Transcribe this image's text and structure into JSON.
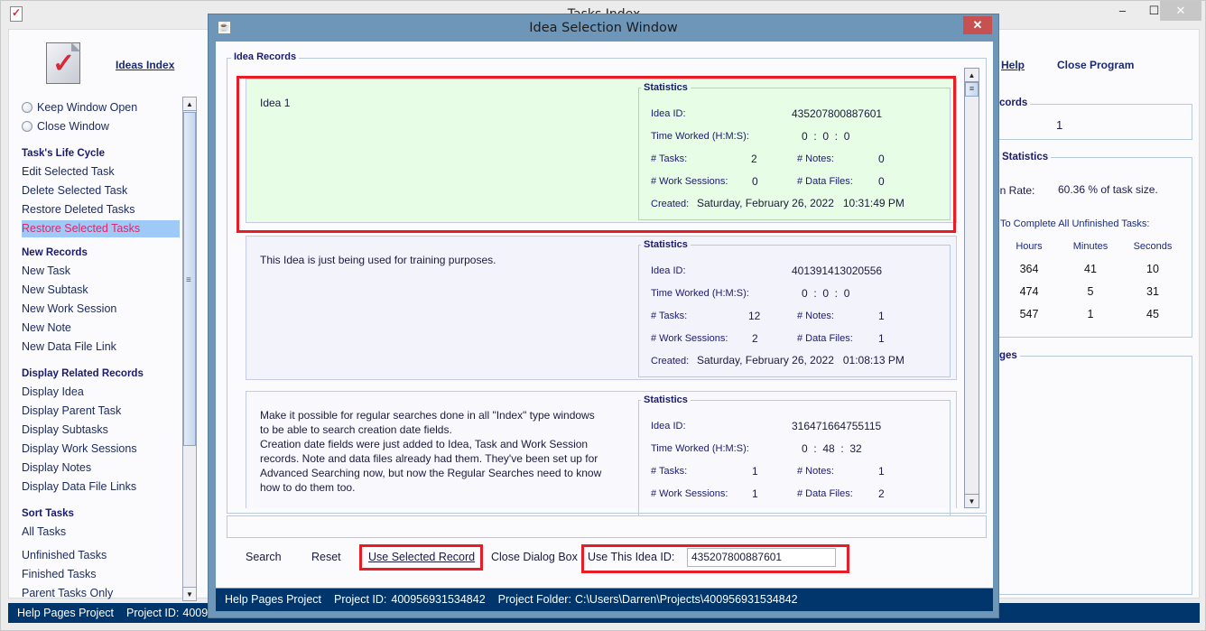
{
  "main_window": {
    "title": "Tasks Index",
    "controls": {
      "minimize": "–",
      "maximize": "☐",
      "close": "✕"
    },
    "top_links": {
      "ideas_index": "Ideas Index",
      "help": "Help",
      "close_program": "Close Program"
    },
    "radios": [
      {
        "label": "Keep Window Open",
        "checked": false
      },
      {
        "label": "Close Window",
        "checked": false
      }
    ],
    "sidebar": {
      "life_cycle_header": "Task's Life Cycle",
      "life_cycle": [
        "Edit Selected Task",
        "Delete Selected Task",
        "Restore Deleted Tasks",
        "Restore Selected Tasks"
      ],
      "new_records_header": "New Records",
      "new_records": [
        "New Task",
        "New Subtask",
        "New Work Session",
        "New Note",
        "New Data File Link"
      ],
      "display_header": "Display Related Records",
      "display": [
        "Display Idea",
        "Display Parent Task",
        "Display Subtasks",
        "Display Work Sessions",
        "Display Notes",
        "Display Data File Links"
      ],
      "sort_header": "Sort Tasks",
      "sort": [
        "All Tasks",
        "Unfinished Tasks",
        "Finished Tasks",
        "Parent Tasks Only"
      ],
      "selected_item": "Restore Selected Tasks"
    },
    "right_panels": {
      "records_legend": "cords",
      "records_count": "1",
      "statistics_legend": "Statistics",
      "rate_label": "on Rate:",
      "rate_value": "60.36 % of task size.",
      "to_complete_label": "To Complete All Unfinished Tasks:",
      "columns": [
        "Hours",
        "Minutes",
        "Seconds"
      ],
      "rows": [
        [
          "364",
          "41",
          "10"
        ],
        [
          "474",
          "5",
          "31"
        ],
        [
          "547",
          "1",
          "45"
        ]
      ],
      "messages_legend": "ges"
    },
    "status": {
      "project": "Help Pages Project",
      "project_id_label": "Project ID:",
      "project_id": "4009"
    }
  },
  "dialog": {
    "title": "Idea Selection Window",
    "close": "✕",
    "records_legend": "Idea Records",
    "records": [
      {
        "description": "Idea 1",
        "statistics_legend": "Statistics",
        "idea_id_label": "Idea ID:",
        "idea_id": "435207800887601",
        "time_label": "Time Worked (H:M:S):",
        "time": "0  :  0  :  0",
        "tasks_label": "# Tasks:",
        "tasks": "2",
        "notes_label": "# Notes:",
        "notes": "0",
        "sessions_label": "# Work Sessions:",
        "sessions": "0",
        "files_label": "# Data Files:",
        "files": "0",
        "created_label": "Created:",
        "created": "Saturday, February 26, 2022   10:31:49 PM",
        "selected": true
      },
      {
        "description": "This Idea is just being used for training purposes.",
        "statistics_legend": "Statistics",
        "idea_id_label": "Idea ID:",
        "idea_id": "401391413020556",
        "time_label": "Time Worked (H:M:S):",
        "time": "0  :  0  :  0",
        "tasks_label": "# Tasks:",
        "tasks": "12",
        "notes_label": "# Notes:",
        "notes": "1",
        "sessions_label": "# Work Sessions:",
        "sessions": "2",
        "files_label": "# Data Files:",
        "files": "1",
        "created_label": "Created:",
        "created": "Saturday, February 26, 2022   01:08:13 PM",
        "selected": false
      },
      {
        "description": "Make it possible for regular searches done in all \"Index\" type windows\nto be able to search creation date fields.\nCreation date fields were just added to Idea, Task and Work Session\nrecords. Note and data files already had them. They've been set up for\nAdvanced Searching now, but now the Regular Searches need to know\nhow to do them too.",
        "statistics_legend": "Statistics",
        "idea_id_label": "Idea ID:",
        "idea_id": "316471664755115",
        "time_label": "Time Worked (H:M:S):",
        "time": "0  :  48  :  32",
        "tasks_label": "# Tasks:",
        "tasks": "1",
        "notes_label": "# Notes:",
        "notes": "1",
        "sessions_label": "# Work Sessions:",
        "sessions": "1",
        "files_label": "# Data Files:",
        "files": "2",
        "selected": false
      }
    ],
    "message": "",
    "buttons": {
      "search": "Search",
      "reset": "Reset",
      "use_selected": "Use Selected Record",
      "close_dialog": "Close Dialog Box"
    },
    "use_id_label": "Use This Idea ID:",
    "use_id_value": "435207800887601",
    "status": {
      "project": "Help Pages Project",
      "project_id_label": "Project ID:",
      "project_id": "400956931534842",
      "folder_label": "Project Folder:",
      "folder": "C:\\Users\\Darren\\Projects\\400956931534842"
    }
  },
  "colors": {
    "selection_highlight": "#e81c24",
    "status_bar": "#00366b",
    "selected_record_bg": "#e8fde6",
    "dialog_frame": "#6e96b8",
    "sidebar_selected_bg": "#9fcaf7",
    "sidebar_selected_text": "#e0246a"
  }
}
